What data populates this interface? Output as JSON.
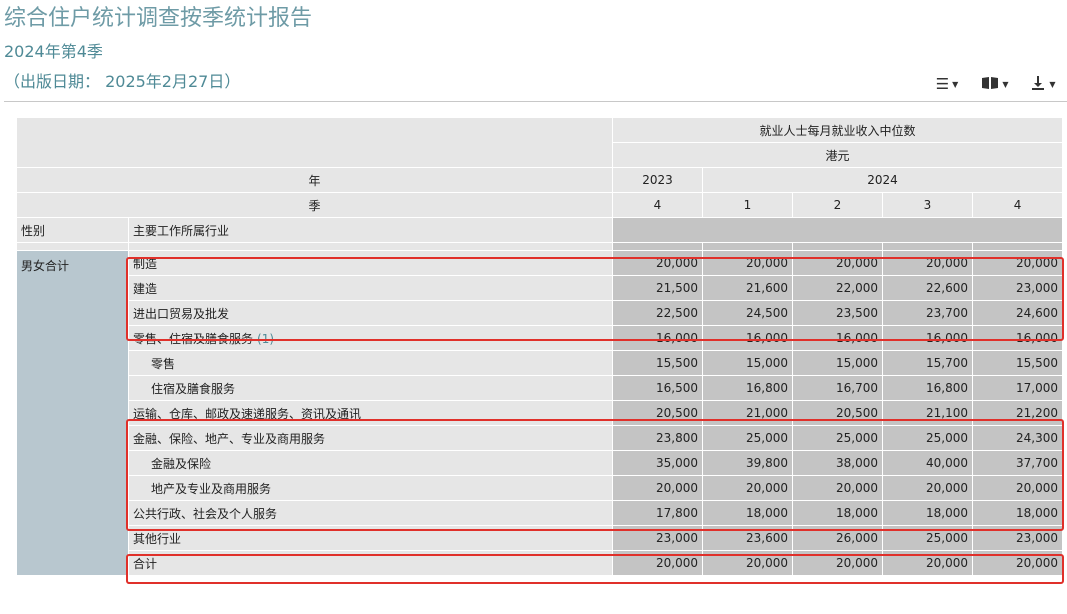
{
  "header": {
    "title": "综合住户统计调查按季统计报告",
    "subtitle": "2024年第4季",
    "pub_date": "（出版日期： 2025年2月27日）"
  },
  "toolbar": [
    {
      "icon": "list-icon",
      "glyph": "☰"
    },
    {
      "icon": "book-icon",
      "glyph": "📖"
    },
    {
      "icon": "download-icon",
      "glyph": "⤓"
    }
  ],
  "table": {
    "measure": "就业人士每月就业收入中位数",
    "unit": "港元",
    "year_label": "年",
    "quarter_label": "季",
    "years": [
      "2023",
      "2024"
    ],
    "quarters": [
      "4",
      "1",
      "2",
      "3",
      "4"
    ],
    "col_sex": "性别",
    "col_industry": "主要工作所属行业",
    "sex_value": "男女合计",
    "rows": [
      {
        "label": "制造",
        "note": "",
        "values": [
          "20,000",
          "20,000",
          "20,000",
          "20,000",
          "20,000"
        ]
      },
      {
        "label": "建造",
        "note": "",
        "values": [
          "21,500",
          "21,600",
          "22,000",
          "22,600",
          "23,000"
        ]
      },
      {
        "label": "进出口贸易及批发",
        "note": "",
        "values": [
          "22,500",
          "24,500",
          "23,500",
          "23,700",
          "24,600"
        ]
      },
      {
        "label": "零售、住宿及膳食服务",
        "note": "(1)",
        "values": [
          "16,000",
          "16,000",
          "16,000",
          "16,000",
          "16,000"
        ]
      },
      {
        "label": "零售",
        "note": "",
        "values": [
          "15,500",
          "15,000",
          "15,000",
          "15,700",
          "15,500"
        ]
      },
      {
        "label": "住宿及膳食服务",
        "note": "",
        "values": [
          "16,500",
          "16,800",
          "16,700",
          "16,800",
          "17,000"
        ]
      },
      {
        "label": "运输、仓库、邮政及速递服务、资讯及通讯",
        "note": "",
        "values": [
          "20,500",
          "21,000",
          "20,500",
          "21,100",
          "21,200"
        ]
      },
      {
        "label": "金融、保险、地产、专业及商用服务",
        "note": "",
        "values": [
          "23,800",
          "25,000",
          "25,000",
          "25,000",
          "24,300"
        ]
      },
      {
        "label": "金融及保险",
        "note": "",
        "values": [
          "35,000",
          "39,800",
          "38,000",
          "40,000",
          "37,700"
        ]
      },
      {
        "label": "地产及专业及商用服务",
        "note": "",
        "values": [
          "20,000",
          "20,000",
          "20,000",
          "20,000",
          "20,000"
        ]
      },
      {
        "label": "公共行政、社会及个人服务",
        "note": "",
        "values": [
          "17,800",
          "18,000",
          "18,000",
          "18,000",
          "18,000"
        ]
      },
      {
        "label": "其他行业",
        "note": "",
        "values": [
          "23,000",
          "23,600",
          "26,000",
          "25,000",
          "23,000"
        ]
      },
      {
        "label": "合计",
        "note": "",
        "values": [
          "20,000",
          "20,000",
          "20,000",
          "20,000",
          "20,000"
        ]
      }
    ]
  },
  "highlight_color": "#e0302a"
}
